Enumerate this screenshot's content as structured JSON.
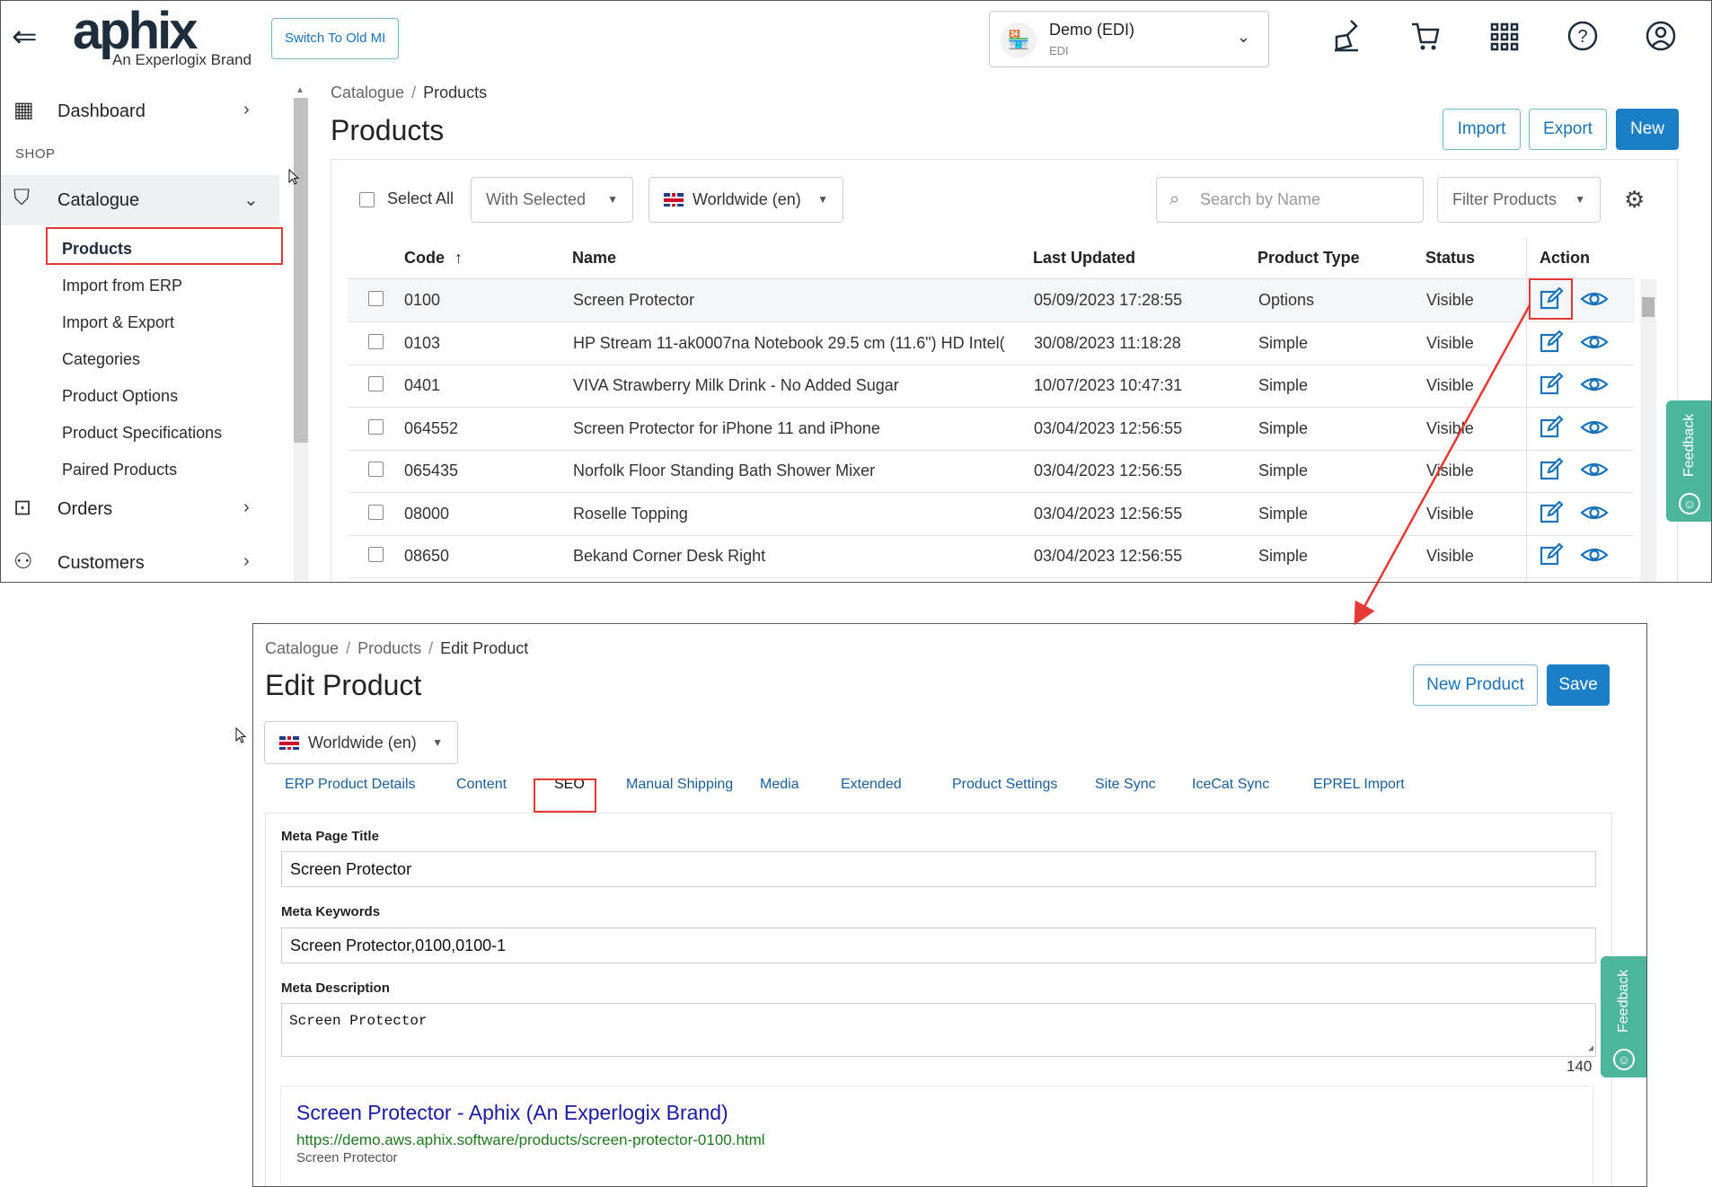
{
  "top": {
    "header": {
      "logo_text": "aphix",
      "logo_sub": "An Experlogix Brand",
      "switch_button": "Switch To Old MI",
      "store": {
        "name": "Demo (EDI)",
        "code": "EDI"
      },
      "icons": [
        "broom-icon",
        "cart-icon",
        "apps-grid-icon",
        "help-icon",
        "user-icon"
      ]
    },
    "sidebar": {
      "dashboard": "Dashboard",
      "section_shop": "SHOP",
      "catalogue": "Catalogue",
      "sub_items": [
        "Products",
        "Import from ERP",
        "Import & Export",
        "Categories",
        "Product Options",
        "Product Specifications",
        "Paired Products"
      ],
      "orders": "Orders",
      "customers": "Customers"
    },
    "breadcrumb": {
      "root": "Catalogue",
      "current": "Products"
    },
    "page_title": "Products",
    "buttons": {
      "import": "Import",
      "export": "Export",
      "new": "New"
    },
    "toolbar": {
      "select_all": "Select All",
      "with_selected": "With Selected",
      "locale": "Worldwide (en)",
      "search_placeholder": "Search by Name",
      "filter": "Filter Products"
    },
    "table": {
      "columns": [
        "Code",
        "Name",
        "Last Updated",
        "Product Type",
        "Status",
        "Action"
      ],
      "sort_indicator": "↑",
      "rows": [
        {
          "code": "0100",
          "name": "Screen Protector",
          "updated": "05/09/2023 17:28:55",
          "type": "Options",
          "status": "Visible"
        },
        {
          "code": "0103",
          "name": "HP Stream 11-ak0007na Notebook 29.5 cm (11.6\") HD Intel(",
          "updated": "30/08/2023 11:18:28",
          "type": "Simple",
          "status": "Visible"
        },
        {
          "code": "0401",
          "name": "VIVA Strawberry Milk Drink - No Added Sugar",
          "updated": "10/07/2023 10:47:31",
          "type": "Simple",
          "status": "Visible"
        },
        {
          "code": "064552",
          "name": "Screen Protector for iPhone 11 and iPhone",
          "updated": "03/04/2023 12:56:55",
          "type": "Simple",
          "status": "Visible"
        },
        {
          "code": "065435",
          "name": "Norfolk Floor Standing Bath Shower Mixer",
          "updated": "03/04/2023 12:56:55",
          "type": "Simple",
          "status": "Visible"
        },
        {
          "code": "08000",
          "name": "Roselle Topping",
          "updated": "03/04/2023 12:56:55",
          "type": "Simple",
          "status": "Visible"
        },
        {
          "code": "08650",
          "name": "Bekand Corner Desk Right",
          "updated": "03/04/2023 12:56:55",
          "type": "Simple",
          "status": "Visible"
        }
      ]
    },
    "feedback": "Feedback"
  },
  "bottom": {
    "breadcrumb": {
      "root": "Catalogue",
      "mid": "Products",
      "current": "Edit Product"
    },
    "page_title": "Edit Product",
    "buttons": {
      "new_product": "New Product",
      "save": "Save"
    },
    "locale": "Worldwide (en)",
    "tabs": [
      "ERP Product Details",
      "Content",
      "SEO",
      "Manual Shipping",
      "Media",
      "Extended",
      "Product Settings",
      "Site Sync",
      "IceCat Sync",
      "EPREL Import"
    ],
    "fields": {
      "meta_title_label": "Meta Page Title",
      "meta_title_value": "Screen Protector",
      "meta_keywords_label": "Meta Keywords",
      "meta_keywords_value": "Screen Protector,0100,0100-1",
      "meta_description_label": "Meta Description",
      "meta_description_value": "Screen Protector",
      "char_counter": "140"
    },
    "serp_preview": {
      "title": "Screen Protector - Aphix (An Experlogix Brand)",
      "url": "https://demo.aws.aphix.software/products/screen-protector-0100.html",
      "description": "Screen Protector"
    },
    "feedback": "Feedback"
  },
  "colors": {
    "accent": "#1a7fc4",
    "highlight": "#e53935",
    "feedback": "#4db59a"
  }
}
